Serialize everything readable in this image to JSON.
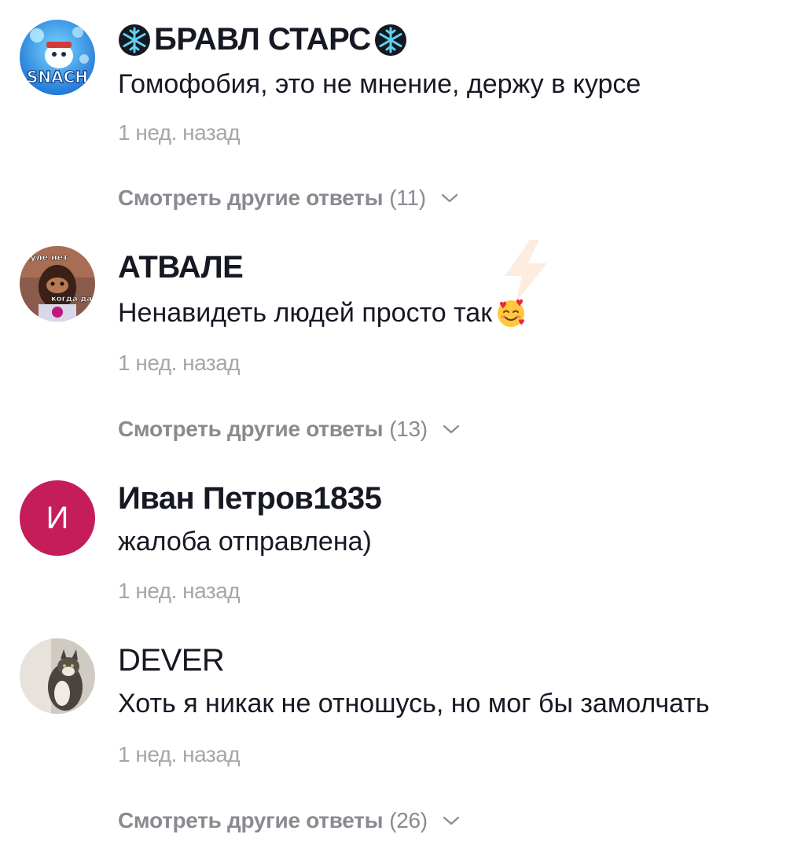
{
  "comments": [
    {
      "username": "БРАВЛ СТАРС",
      "text": "Гомофобия, это не мнение, держу в курсе",
      "time": "1 нед. назад",
      "replies_label": "Смотреть другие ответы",
      "replies_count": "(11)",
      "avatar_badge_text": "SNACH"
    },
    {
      "username": "АТВАЛЕ",
      "text": "Ненавидеть людей просто так",
      "time": "1 нед. назад",
      "replies_label": "Смотреть другие ответы",
      "replies_count": "(13)",
      "avatar_caption_top": "куле нет",
      "avatar_caption_bottom": "когда да"
    },
    {
      "username": "Иван Петров1835",
      "text": "жалоба отправлена)",
      "time": "1 нед. назад",
      "avatar_letter": "И"
    },
    {
      "username": "DEVER",
      "text": "Хоть я никак не отношусь, но мог бы замолчать",
      "time": "1 нед. назад",
      "replies_label": "Смотреть другие ответы",
      "replies_count": "(26)"
    }
  ],
  "icons": {
    "snowflake": "snowflake-icon",
    "emoji": "smiling-face-with-hearts-emoji",
    "chevron": "chevron-down-icon"
  },
  "colors": {
    "text": "#161823",
    "muted": "#a5a6ab",
    "replies": "#8a8b91",
    "avatar_letter_bg": "#c51d5a"
  }
}
